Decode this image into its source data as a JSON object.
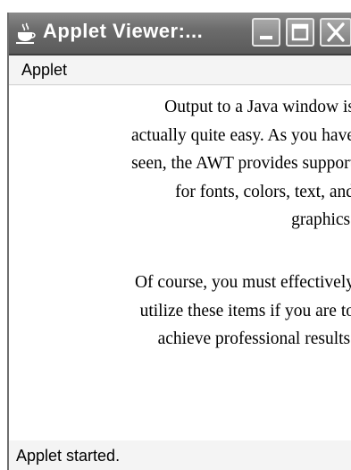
{
  "window": {
    "title": "Applet Viewer:...",
    "icon": "java-cup-icon"
  },
  "titlebar_buttons": {
    "minimize": "minimize-icon",
    "maximize": "maximize-icon",
    "close": "close-icon"
  },
  "menu": {
    "label": "Applet"
  },
  "content": {
    "paragraph1": [
      "Output to a Java window is",
      "actually quite easy. As you have",
      "seen, the AWT provides support",
      "for fonts, colors, text, and",
      "graphics."
    ],
    "paragraph2": [
      "Of course, you must effectively",
      "utilize these items if you are to",
      "achieve professional results."
    ]
  },
  "status": {
    "text": "Applet started."
  }
}
